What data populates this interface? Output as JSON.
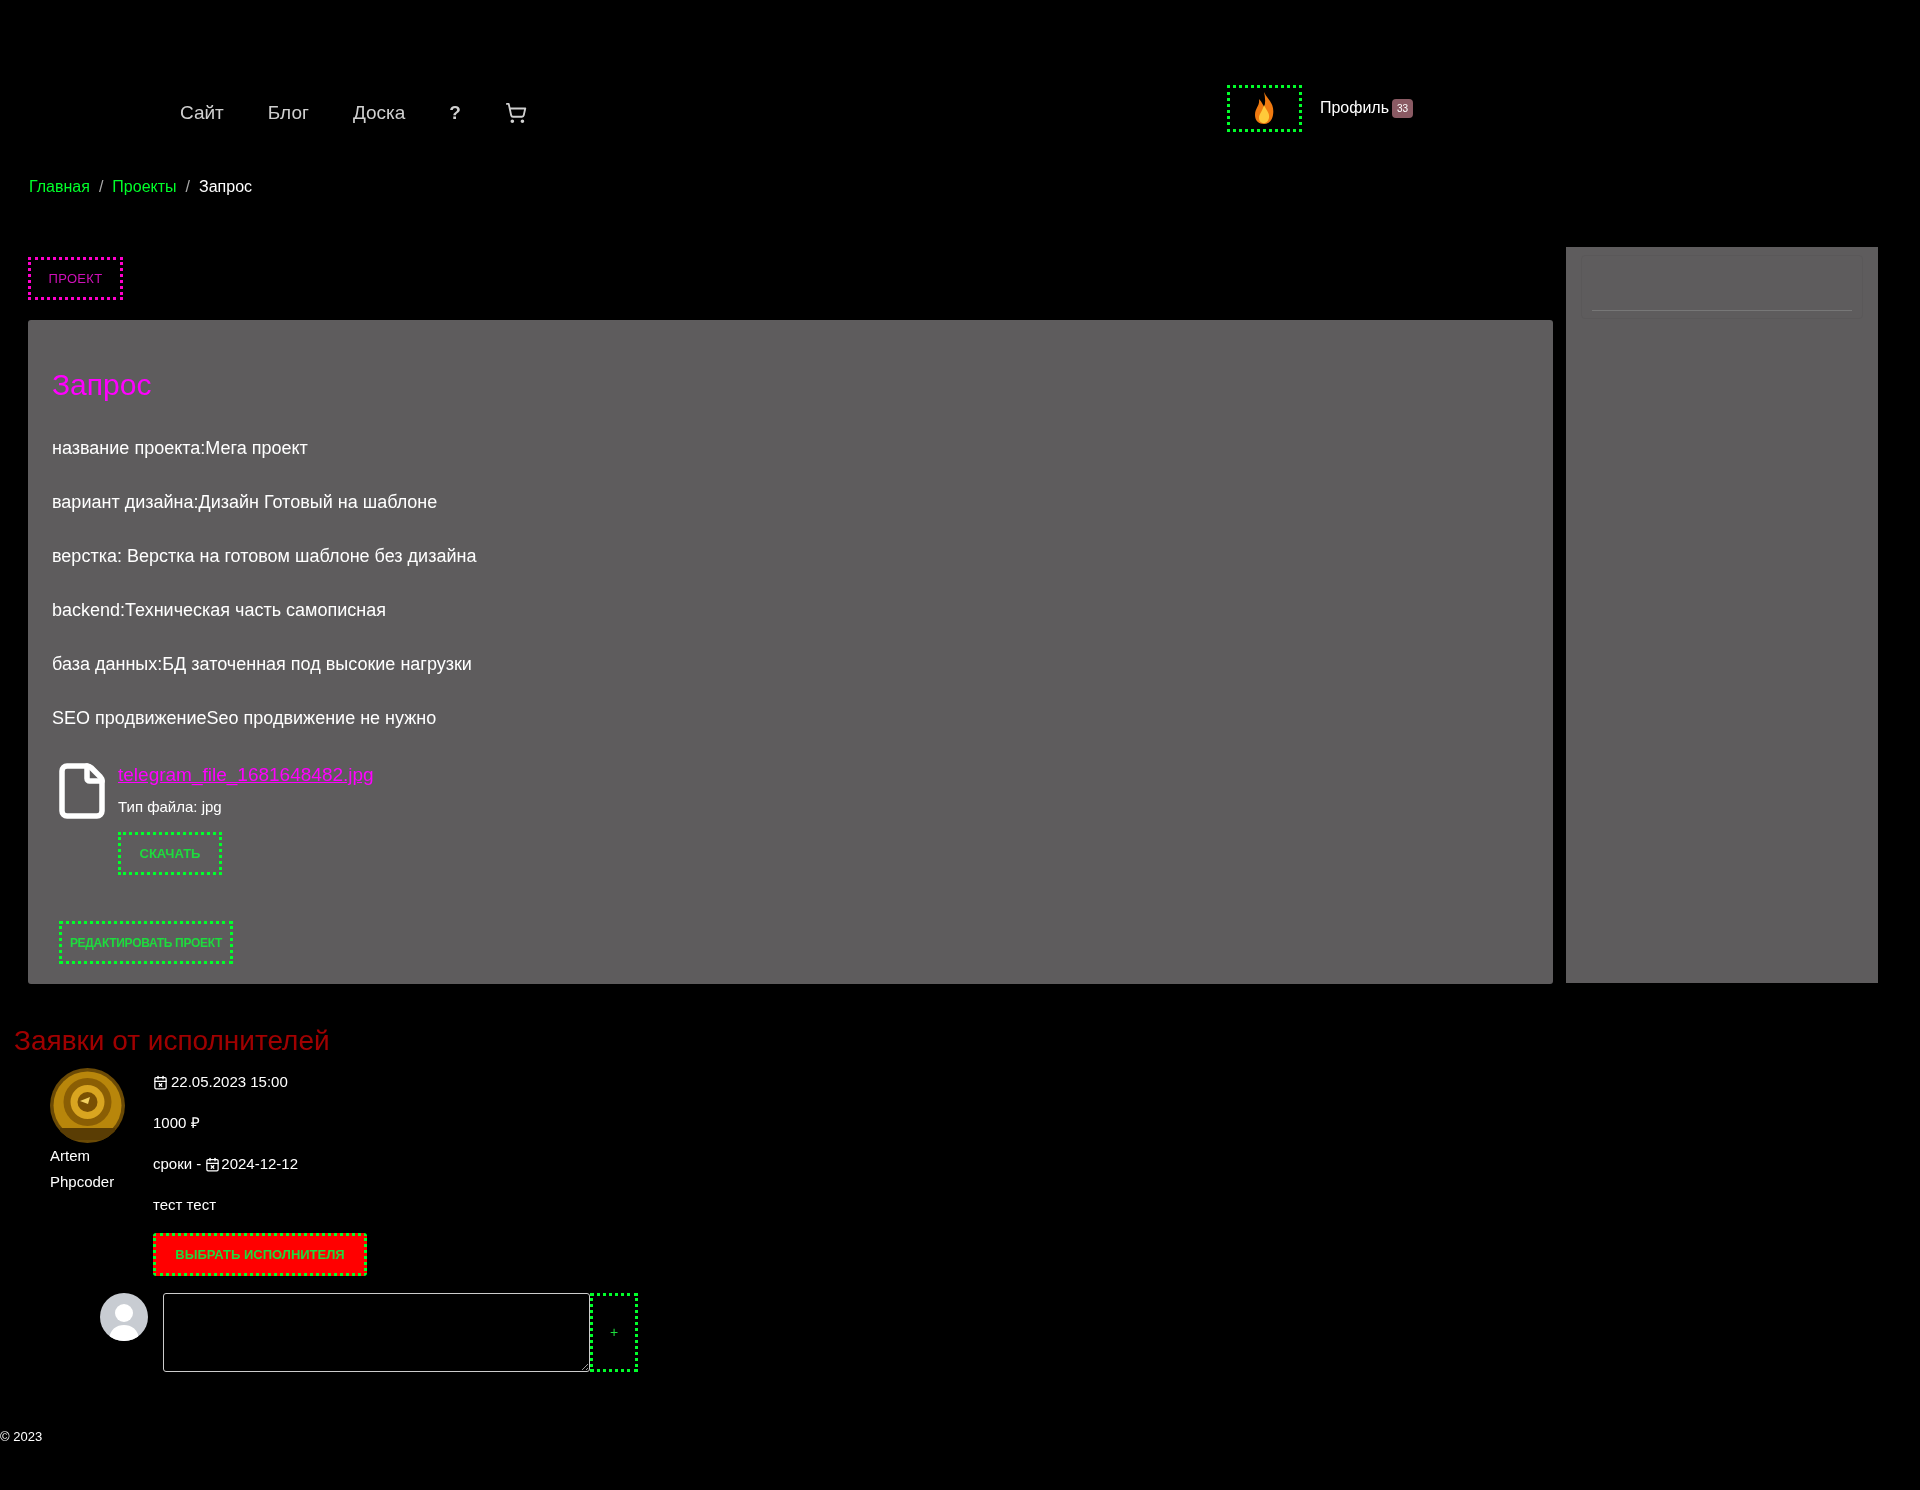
{
  "nav": {
    "links": [
      {
        "label": "Сайт"
      },
      {
        "label": "Блог"
      },
      {
        "label": "Доска"
      },
      {
        "label": "?"
      }
    ]
  },
  "profile": {
    "label": "Профиль",
    "badge": "33"
  },
  "breadcrumb": [
    {
      "label": "Главная",
      "kind": "link"
    },
    {
      "label": "Проекты",
      "kind": "link"
    },
    {
      "label": "Запрос",
      "kind": "current"
    }
  ],
  "breadcrumb_separator": "/",
  "tag": "ПРОЕКТ",
  "project": {
    "title": "Запрос",
    "fields": [
      "название проекта:Мега проект",
      "вариант дизайна:Дизайн Готовый на шаблоне",
      "верстка: Верстка на готовом шаблоне без дизайна",
      "backend:Техническая часть самописная",
      "база данных:БД заточенная под высокие нагрузки",
      "SEO продвижениеSeo продвижение не нужно"
    ],
    "file": {
      "name": "telegram_file_1681648482.jpg",
      "type_label": "Тип файла: jpg",
      "download": "СКАЧАТЬ"
    },
    "edit_button": "РЕДАКТИРОВАТЬ ПРОЕКТ"
  },
  "bids": {
    "title": "Заявки от исполнителей",
    "items": [
      {
        "author_lines": [
          "Artem",
          "Phpcoder"
        ],
        "date": "22.05.2023 15:00",
        "price": "1000 ₽",
        "deadline_label": "сроки -",
        "deadline": "2024-12-12",
        "message": "тест тест",
        "select_button": "ВЫБРАТЬ ИСПОЛНИТЕЛЯ"
      }
    ]
  },
  "comment": {
    "submit": "+"
  },
  "footer": "© 2023"
}
